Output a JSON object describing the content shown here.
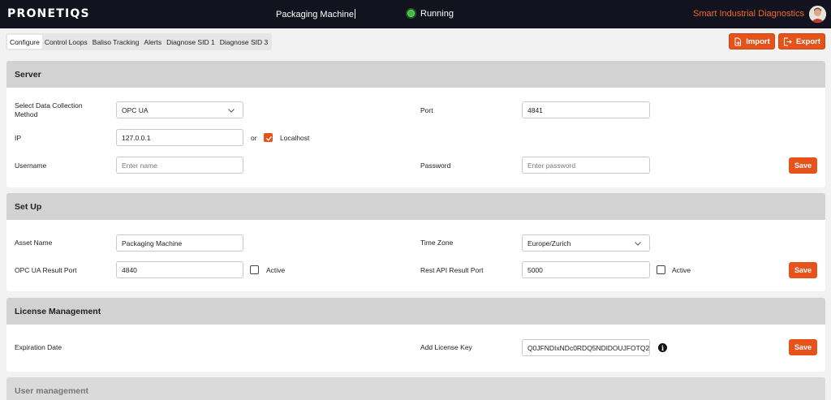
{
  "header": {
    "logo": "PRONETIQS",
    "machine_name": "Packaging Machine",
    "status": "Running",
    "brand": "Smart Industrial Diagnostics",
    "colors": {
      "bar": "#13131f",
      "accent": "#e5531b",
      "brand_text": "#ee6a2c",
      "status_ok": "#3fb83f"
    }
  },
  "tabs": [
    {
      "label": "Configure",
      "active": true
    },
    {
      "label": "Control Loops"
    },
    {
      "label": "Baliso Tracking"
    },
    {
      "label": "Alerts"
    },
    {
      "label": "Diagnose SID 1"
    },
    {
      "label": "Diagnose SID 3"
    }
  ],
  "actions": {
    "import_label": "Import",
    "export_label": "Export"
  },
  "server": {
    "title": "Server",
    "method_label": "Select Data Collection Method",
    "method_value": "OPC UA",
    "port_label": "Port",
    "port_value": "4841",
    "ip_label": "IP",
    "ip_value": "127.0.0.1",
    "or_label": "or",
    "localhost_label": "Localhost",
    "localhost_checked": true,
    "username_label": "Username",
    "username_placeholder": "Enter name",
    "password_label": "Password",
    "password_placeholder": "Enter password",
    "save_label": "Save"
  },
  "setup": {
    "title": "Set Up",
    "asset_label": "Asset Name",
    "asset_value": "Packaging Machine",
    "timezone_label": "Time Zone",
    "timezone_value": "Europe/Zurich",
    "opcua_port_label": "OPC UA Result Port",
    "opcua_port_value": "4840",
    "opcua_active_label": "Active",
    "rest_port_label": "Rest API Result Port",
    "rest_port_value": "5000",
    "rest_active_label": "Active",
    "save_label": "Save"
  },
  "license": {
    "title": "License Management",
    "expiration_label": "Expiration Date",
    "key_label": "Add License Key",
    "key_value": "Q0JFNDIxNDc0RDQ5NDlDOUJFOTQ2",
    "info_glyph": "i",
    "save_label": "Save"
  },
  "user_management": {
    "title": "User management"
  }
}
